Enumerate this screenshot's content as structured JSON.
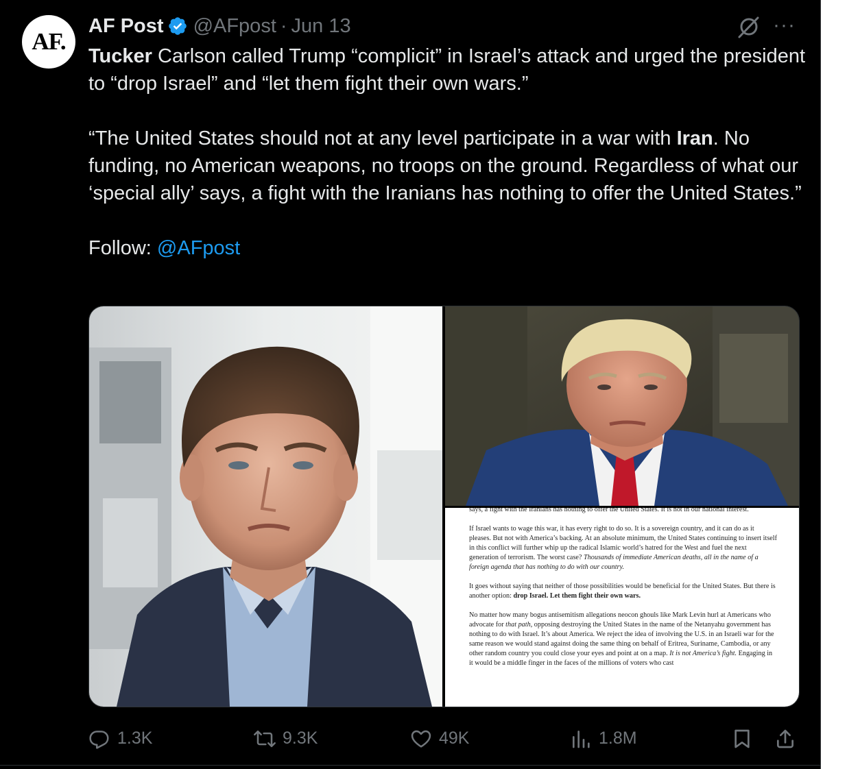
{
  "tweet": {
    "avatar_text": "AF.",
    "author_name": "AF Post",
    "handle": "@AFpost",
    "separator": "·",
    "date": "Jun 13",
    "more_label": "···",
    "para1_bold": "Tucker",
    "para1_rest": " Carlson called Trump “complicit” in Israel’s attack and urged the president to “drop Israel” and “let them fight their own wars.”",
    "para2_start": "“The United States should not at any level participate in a war with ",
    "para2_bold": "Iran",
    "para2_rest": ". No funding, no American weapons, no troops on the ground. Regardless of what our ‘special ally’ says, a fight with the Iranians has nothing to offer the United States.”",
    "follow_label": "Follow: ",
    "follow_link": "@AFpost"
  },
  "document": {
    "p1": "says, a fight with the Iranians has nothing to offer the United States. It is not in our national interest.",
    "p2": "If Israel wants to wage this war, it has every right to do so. It is a sovereign country, and it can do as it pleases. But not with America’s backing. At an absolute minimum, the United States continuing to insert itself in this conflict will further whip up the radical Islamic world’s hatred for the West and fuel the next generation of terrorism. The worst case?",
    "p2_italic": "Thousands of immediate American deaths, all in the name of a foreign agenda that has nothing to do with our country.",
    "p3": "It goes without saying that neither of those possibilities would be beneficial for the United States. But there is another option: ",
    "p3_bold": "drop Israel. Let them fight their own wars.",
    "p4_a": "No matter how many bogus antisemitism allegations neocon ghouls like Mark Levin hurl at Americans who advocate for ",
    "p4_italic1": "that path",
    "p4_b": ", opposing destroying the United States in the name of the Netanyahu government has nothing to do with Israel. It’s about America. We reject the idea of involving the U.S. in an Israeli war for the same reason we would stand against doing the same thing on behalf of Eritrea, Suriname, Cambodia, or any other random country you could close your eyes and point at on a map. ",
    "p4_italic2": "It is not America’s fight.",
    "p4_c": " Engaging in it would be a middle finger in the faces of the millions of voters who cast"
  },
  "actions": {
    "replies": "1.3K",
    "reposts": "9.3K",
    "likes": "49K",
    "views": "1.8M"
  },
  "colors": {
    "background": "#000000",
    "text": "#e7e9ea",
    "muted": "#71767b",
    "link": "#1d9bf0",
    "verified": "#1d9bf0"
  },
  "icons": [
    "verified-badge-icon",
    "grok-icon",
    "more-icon",
    "reply-icon",
    "repost-icon",
    "like-icon",
    "views-icon",
    "bookmark-icon",
    "share-icon"
  ]
}
